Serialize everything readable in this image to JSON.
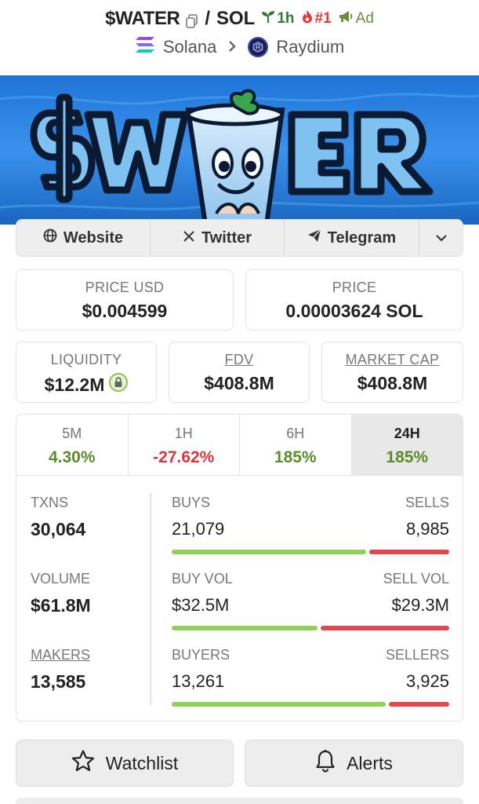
{
  "header": {
    "token_symbol": "$WATER",
    "separator": "/",
    "quote_symbol": "SOL",
    "age_label": "1h",
    "rank_label": "#1",
    "ad_label": "Ad",
    "chain": "Solana",
    "dex": "Raydium"
  },
  "banner": {
    "logo_text": "$WATER"
  },
  "links": {
    "website": "Website",
    "twitter": "Twitter",
    "telegram": "Telegram"
  },
  "price": {
    "usd_label": "PRICE USD",
    "usd_value": "$0.004599",
    "native_label": "PRICE",
    "native_value": "0.00003624 SOL"
  },
  "metrics": {
    "liquidity_label": "LIQUIDITY",
    "liquidity_value": "$12.2M",
    "fdv_label": "FDV",
    "fdv_value": "$408.8M",
    "mcap_label": "MARKET CAP",
    "mcap_value": "$408.8M"
  },
  "tabs": [
    {
      "label": "5M",
      "value": "4.30%",
      "trend": "up"
    },
    {
      "label": "1H",
      "value": "-27.62%",
      "trend": "down"
    },
    {
      "label": "6H",
      "value": "185%",
      "trend": "up"
    },
    {
      "label": "24H",
      "value": "185%",
      "trend": "up",
      "active": true
    }
  ],
  "stats": {
    "txns_label": "TXNS",
    "txns_value": "30,064",
    "buys_label": "BUYS",
    "buys_value": "21,079",
    "sells_label": "SELLS",
    "sells_value": "8,985",
    "volume_label": "VOLUME",
    "volume_value": "$61.8M",
    "buy_vol_label": "BUY VOL",
    "buy_vol_value": "$32.5M",
    "sell_vol_label": "SELL VOL",
    "sell_vol_value": "$29.3M",
    "makers_label": "MAKERS",
    "makers_value": "13,585",
    "buyers_label": "BUYERS",
    "buyers_value": "13,261",
    "sellers_label": "SELLERS",
    "sellers_value": "3,925",
    "buy_share_txns": 0.7011,
    "buy_share_volume": 0.5259,
    "buy_share_makers": 0.7716
  },
  "actions": {
    "watchlist": "Watchlist",
    "alerts": "Alerts"
  },
  "colors": {
    "positive": "#5b8c2a",
    "negative": "#d9363e",
    "buy_bar": "#8fcf5a",
    "sell_bar": "#e2474e",
    "banner_blue": "#2b86e8"
  }
}
